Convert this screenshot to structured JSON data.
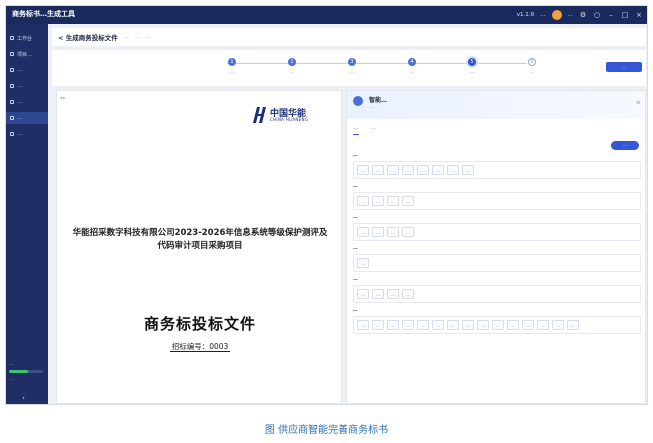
{
  "app": {
    "title": "商务标书…生成工具",
    "topbar": {
      "version": "v1.1.9",
      "account_info": "…",
      "user_name": "…"
    }
  },
  "sidebar": {
    "items": [
      {
        "label": "工作台"
      },
      {
        "label": "项目…"
      },
      {
        "label": "…"
      },
      {
        "label": "…"
      },
      {
        "label": "…"
      },
      {
        "label": "…"
      },
      {
        "label": "…"
      }
    ],
    "active_index": 5,
    "usage": {
      "label": "…",
      "fraction": 0.55,
      "text": "…"
    }
  },
  "header": {
    "page_title": "< 生成商务投标文件",
    "meta": [
      "…",
      "…",
      "…"
    ]
  },
  "stepper": {
    "steps": [
      {
        "num": "1",
        "label": "…"
      },
      {
        "num": "2",
        "label": "…"
      },
      {
        "num": "3",
        "label": "…"
      },
      {
        "num": "4",
        "label": "…"
      },
      {
        "num": "5",
        "label": "…"
      },
      {
        "num": "6",
        "label": "…"
      }
    ],
    "active_index": 4,
    "action_label": "…"
  },
  "document": {
    "logo_text_cn": "中国华能",
    "logo_text_en": "CHINA HUANENG",
    "company_project": "华能招采数字科技有限公司2023-2026年信息系统等级保护测评及代码审计项目采购项目",
    "title": "商务标投标文件",
    "number": "招标编号：0003"
  },
  "assistant": {
    "title": "智能…",
    "subtitle": "…",
    "tabs": [
      {
        "label": "…"
      },
      {
        "label": "…"
      }
    ],
    "active_tab": 0,
    "action_label": "…",
    "sections": [
      {
        "title": "…",
        "chips": [
          "…",
          "…",
          "…",
          "…",
          "…",
          "…",
          "…",
          "…"
        ]
      },
      {
        "title": "…",
        "chips": [
          "…",
          "…",
          "…",
          "…"
        ]
      },
      {
        "title": "…",
        "chips": [
          "…",
          "…",
          "…",
          "…"
        ]
      },
      {
        "title": "…",
        "chips": [
          "…"
        ]
      },
      {
        "title": "…",
        "chips": [
          "…",
          "…",
          "…",
          "…"
        ]
      },
      {
        "title": "…",
        "chips": [
          "…",
          "…",
          "…",
          "…",
          "…",
          "…",
          "…",
          "…",
          "…",
          "…",
          "…",
          "…",
          "…",
          "…",
          "…"
        ]
      }
    ]
  },
  "caption": "图 供应商智能完善商务标书"
}
